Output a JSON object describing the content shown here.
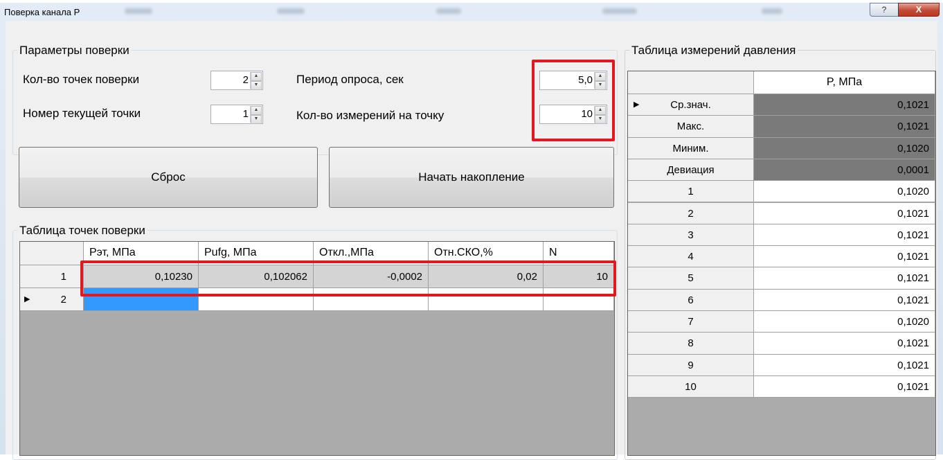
{
  "window": {
    "title": "Поверка канала P",
    "help_label": "?",
    "close_label": "X"
  },
  "params": {
    "group_title": "Параметры поверки",
    "points_count_label": "Кол-во точек поверки",
    "points_count_value": "2",
    "current_point_label": "Номер текущей точки",
    "current_point_value": "1",
    "poll_period_label": "Период опроса, сек",
    "poll_period_value": "5,0",
    "measurements_label": "Кол-во измерений на точку",
    "measurements_value": "10"
  },
  "buttons": {
    "reset": "Сброс",
    "start": "Начать накопление"
  },
  "points_table": {
    "group_title": "Таблица точек поверки",
    "columns": [
      "Pэт, МПа",
      "Pufg, МПа",
      "Откл.,МПа",
      "Отн.СКО,%",
      "N"
    ],
    "rows": [
      {
        "index": "1",
        "cells": [
          "0,10230",
          "0,102062",
          "-0,0002",
          "0,02",
          "10"
        ]
      },
      {
        "index": "2",
        "cells": [
          "",
          "",
          "",
          "",
          ""
        ]
      }
    ]
  },
  "pressure_table": {
    "group_title": "Таблица измерений давления",
    "column": "P, МПа",
    "rows": [
      {
        "label": "Ср.знач.",
        "value": "0,1021"
      },
      {
        "label": "Макс.",
        "value": "0,1021"
      },
      {
        "label": "Миним.",
        "value": "0,1020"
      },
      {
        "label": "Девиация",
        "value": "0,0001"
      },
      {
        "label": "1",
        "value": "0,1020"
      },
      {
        "label": "2",
        "value": "0,1021"
      },
      {
        "label": "3",
        "value": "0,1021"
      },
      {
        "label": "4",
        "value": "0,1021"
      },
      {
        "label": "5",
        "value": "0,1021"
      },
      {
        "label": "6",
        "value": "0,1021"
      },
      {
        "label": "7",
        "value": "0,1020"
      },
      {
        "label": "8",
        "value": "0,1021"
      },
      {
        "label": "9",
        "value": "0,1021"
      },
      {
        "label": "10",
        "value": "0,1021"
      }
    ]
  },
  "colors": {
    "highlight": "#e3181e",
    "selected_cell": "#3399ff",
    "stat_cell": "#7a7a7a",
    "grid_empty": "#ababab"
  }
}
